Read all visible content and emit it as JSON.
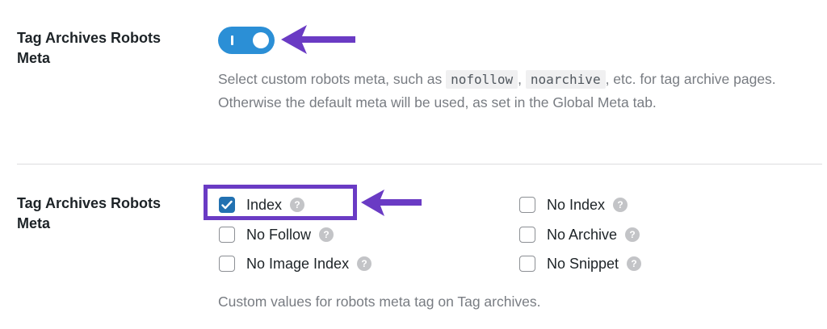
{
  "section1": {
    "label": "Tag Archives Robots Meta",
    "toggle_on": true,
    "description": {
      "before": "Select custom robots meta, such as ",
      "code1": "nofollow",
      "sep": ", ",
      "code2": "noarchive",
      "after": ", etc. for tag archive pages. Otherwise the default meta will be used, as set in the Global Meta tab."
    }
  },
  "section2": {
    "label": "Tag Archives Robots Meta",
    "options": [
      {
        "label": "Index",
        "checked": true
      },
      {
        "label": "No Follow",
        "checked": false
      },
      {
        "label": "No Image Index",
        "checked": false
      },
      {
        "label": "No Index",
        "checked": false
      },
      {
        "label": "No Archive",
        "checked": false
      },
      {
        "label": "No Snippet",
        "checked": false
      }
    ],
    "help_icon": "?",
    "description": "Custom values for robots meta tag on Tag archives."
  },
  "colors": {
    "toggle": "#2b8fd6",
    "checkbox_checked": "#2271b1",
    "annotation": "#6a3bc4"
  }
}
